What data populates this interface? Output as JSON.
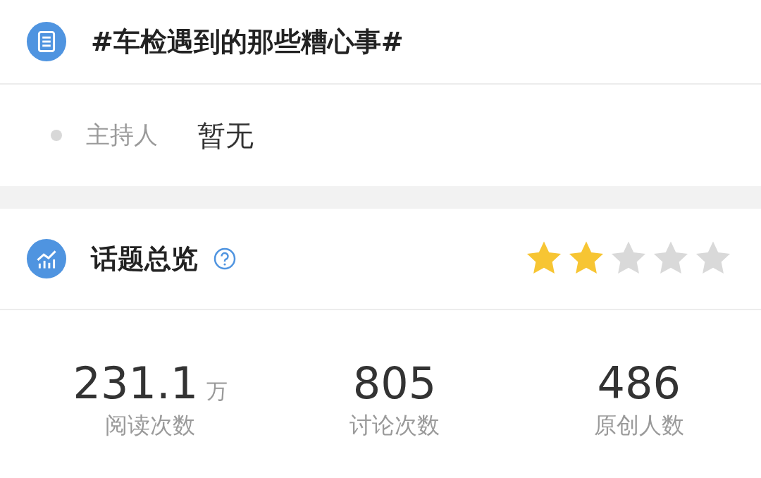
{
  "topic": {
    "title": "#车检遇到的那些糟心事#"
  },
  "host": {
    "label": "主持人",
    "value": "暂无"
  },
  "overview": {
    "title": "话题总览",
    "stars": 2
  },
  "stats": [
    {
      "value": "231.1",
      "unit": "万",
      "label": "阅读次数"
    },
    {
      "value": "805",
      "label": "讨论次数"
    },
    {
      "value": "486",
      "label": "原创人数"
    }
  ]
}
